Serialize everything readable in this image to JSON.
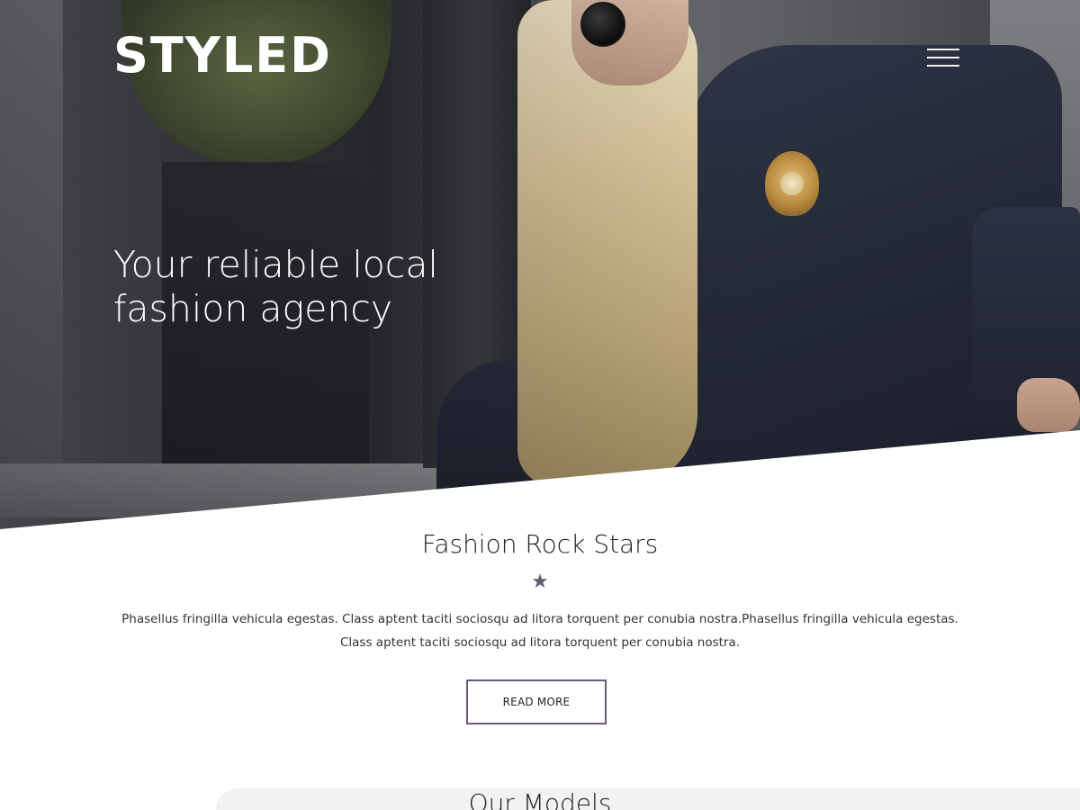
{
  "header": {
    "logo": "STYLED",
    "menu_icon": "hamburger-menu-icon"
  },
  "hero": {
    "tagline_line1": "Your reliable local",
    "tagline_line2": "fashion agency"
  },
  "intro": {
    "title": "Fashion Rock Stars",
    "star_icon": "star-icon",
    "body": "Phasellus fringilla vehicula egestas. Class aptent taciti sociosqu ad litora torquent per conubia nostra.Phasellus fringilla vehicula egestas. Class aptent taciti sociosqu ad litora torquent per conubia nostra.",
    "button_label": "READ MORE"
  },
  "models": {
    "title": "Our Models"
  },
  "colors": {
    "accent": "#6b5a78",
    "text": "#222222",
    "background": "#ffffff"
  }
}
